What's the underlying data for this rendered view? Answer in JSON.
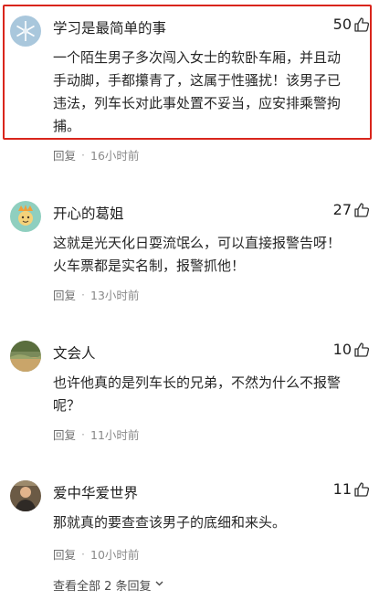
{
  "comments": [
    {
      "user": "学习是最简单的事",
      "likes": "50",
      "lines": [
        "一个陌生男子多次闯入女士的软卧车厢，并且动",
        "手动脚，手都攥青了，这属于性骚扰！该男子已",
        "违法，列车长对此事处置不妥当，应安排乘警拘",
        "捕。"
      ],
      "reply_label": "回复",
      "time": "16小时前",
      "highlighted": true
    },
    {
      "user": "开心的葛姐",
      "likes": "27",
      "lines": [
        "这就是光天化日耍流氓么，可以直接报警告呀！",
        "火车票都是实名制，报警抓他！"
      ],
      "reply_label": "回复",
      "time": "13小时前"
    },
    {
      "user": "文会人",
      "likes": "10",
      "lines": [
        "也许他真的是列车长的兄弟，不然为什么不报警",
        "呢？"
      ],
      "reply_label": "回复",
      "time": "11小时前"
    },
    {
      "user": "爱中华爱世界",
      "likes": "11",
      "lines": [
        "那就真的要查查该男子的底细和来头。"
      ],
      "reply_label": "回复",
      "time": "10小时前"
    }
  ],
  "view_all": "查看全部 2 条回复",
  "icons": {
    "like": "thumbs-up-icon",
    "expand": "chevron-down-icon"
  },
  "colors": {
    "highlight_border": "#d9251c"
  }
}
